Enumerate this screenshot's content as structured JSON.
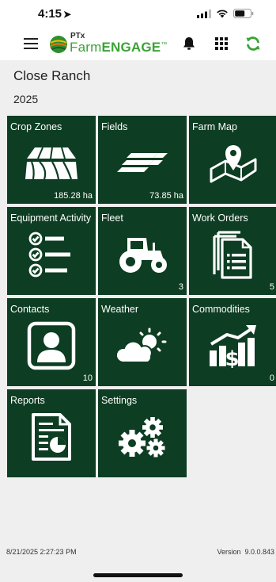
{
  "status_bar": {
    "time": "4:15",
    "location_glyph": "➤"
  },
  "header": {
    "logo_ptx": "PTx",
    "logo_farm": "Farm",
    "logo_engage": "ENGAGE",
    "logo_tm": "™"
  },
  "farm": {
    "name": "Close Ranch",
    "year": "2025"
  },
  "tiles": [
    {
      "label": "Crop Zones",
      "count": "185.28 ha",
      "icon": "crop-field-icon"
    },
    {
      "label": "Fields",
      "count": "73.85 ha",
      "icon": "field-stripes-icon"
    },
    {
      "label": "Farm Map",
      "count": "",
      "icon": "map-pin-icon"
    },
    {
      "label": "Equipment Activity",
      "count": "",
      "icon": "checklist-icon"
    },
    {
      "label": "Fleet",
      "count": "3",
      "icon": "tractor-icon"
    },
    {
      "label": "Work Orders",
      "count": "5",
      "icon": "documents-icon"
    },
    {
      "label": "Contacts",
      "count": "10",
      "icon": "contact-icon"
    },
    {
      "label": "Weather",
      "count": "",
      "icon": "weather-icon"
    },
    {
      "label": "Commodities",
      "count": "0",
      "icon": "commodities-icon"
    },
    {
      "label": "Reports",
      "count": "",
      "icon": "report-icon"
    },
    {
      "label": "Settings",
      "count": "",
      "icon": "gears-icon"
    }
  ],
  "footer": {
    "timestamp": "8/21/2025 2:27:23 PM",
    "version": "Version  9.0.0.843"
  },
  "colors": {
    "tile": "#0d3d22",
    "brand_green": "#3aa335",
    "background": "#efefef"
  }
}
